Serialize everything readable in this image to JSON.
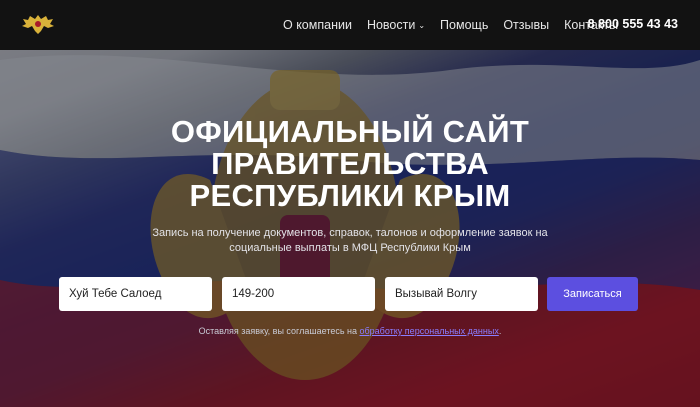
{
  "nav": {
    "items": [
      {
        "label": "О компании",
        "has_dropdown": false
      },
      {
        "label": "Новости",
        "has_dropdown": true
      },
      {
        "label": "Помощь",
        "has_dropdown": false
      },
      {
        "label": "Отзывы",
        "has_dropdown": false
      },
      {
        "label": "Контакты",
        "has_dropdown": false
      }
    ],
    "dropdown_glyph": "⌄",
    "phone": "8 800 555 43 43",
    "logo_icon": "double-headed-eagle-icon"
  },
  "hero": {
    "title_lines": [
      "ОФИЦИАЛЬНЫЙ САЙТ",
      "ПРАВИТЕЛЬСТВА",
      "РЕСПУБЛИКИ КРЫМ"
    ],
    "subtitle": "Запись на получение документов, справок, талонов и оформление заявок на социальные выплаты в МФЦ Республики Крым"
  },
  "form": {
    "name_value": "Хуй Тебе Салоед",
    "phone_value": "149-200",
    "city_value": "Вызывай Волгу",
    "submit_label": "Записаться"
  },
  "consent": {
    "text": "Оставляя заявку, вы соглашаетесь на ",
    "link": "обработку персональных данных",
    "end": "."
  },
  "colors": {
    "navbar_bg": "#121212",
    "accent": "#5c4fe0",
    "link": "#8a7dff",
    "logo_gold": "#d9b23a"
  }
}
